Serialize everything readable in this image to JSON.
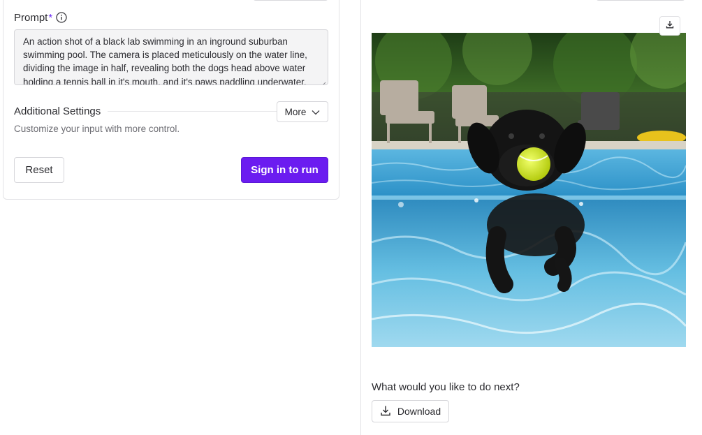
{
  "form": {
    "prompt_label": "Prompt",
    "required_mark": "*",
    "prompt_value": "An action shot of a black lab swimming in an inground suburban swimming pool. The camera is placed meticulously on the water line, dividing the image in half, revealing both the dogs head above water holding a tennis ball in it's mouth, and it's paws paddling underwater.",
    "additional_settings_title": "Additional Settings",
    "more_label": "More",
    "settings_description": "Customize your input with more control.",
    "reset_label": "Reset",
    "signin_label": "Sign in to run"
  },
  "output": {
    "next_title": "What would you like to do next?",
    "download_label": "Download"
  },
  "icons": {
    "info": "info-icon",
    "chevron": "chevron-down-icon",
    "download": "download-icon",
    "resize": "resize-grip-icon"
  },
  "colors": {
    "accent": "#6b1cf0",
    "pool_water": "#3aa3d6",
    "foliage": "#2f5a22"
  }
}
